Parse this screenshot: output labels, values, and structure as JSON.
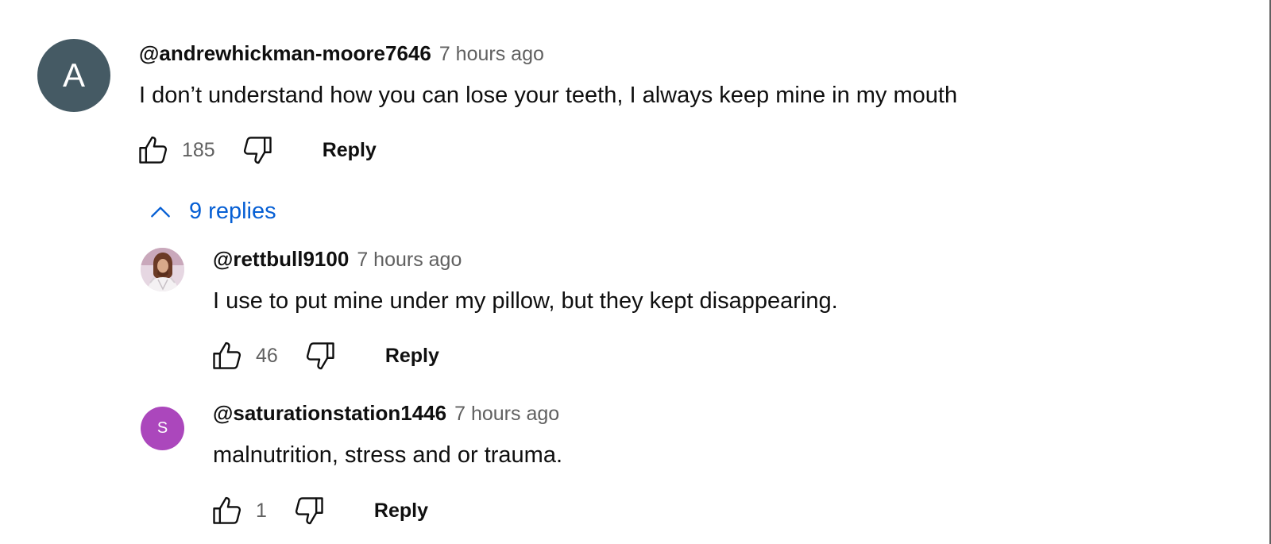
{
  "thread": {
    "comment": {
      "avatar_letter": "A",
      "avatar_color": "#455a64",
      "author": "@andrewhickman-moore7646",
      "time": "7 hours ago",
      "text": "I don’t understand how you can lose your teeth, I always keep mine in my mouth",
      "likes": "185",
      "reply_label": "Reply"
    },
    "replies_toggle": {
      "label": "9 replies",
      "expanded": true,
      "icon": "chevron-up-icon"
    },
    "replies": [
      {
        "avatar": "profile-photo",
        "author": "@rettbull9100",
        "time": "7 hours ago",
        "text": "I use to put mine under my pillow, but they kept disappearing.",
        "likes": "46",
        "reply_label": "Reply"
      },
      {
        "avatar_letter": "S",
        "avatar_color": "#ab47bc",
        "author": "@saturationstation1446",
        "time": "7 hours ago",
        "text": "malnutrition, stress and or trauma.",
        "likes": "1",
        "reply_label": "Reply"
      }
    ]
  },
  "colors": {
    "link_blue": "#065fd4",
    "secondary_text": "#606060"
  }
}
